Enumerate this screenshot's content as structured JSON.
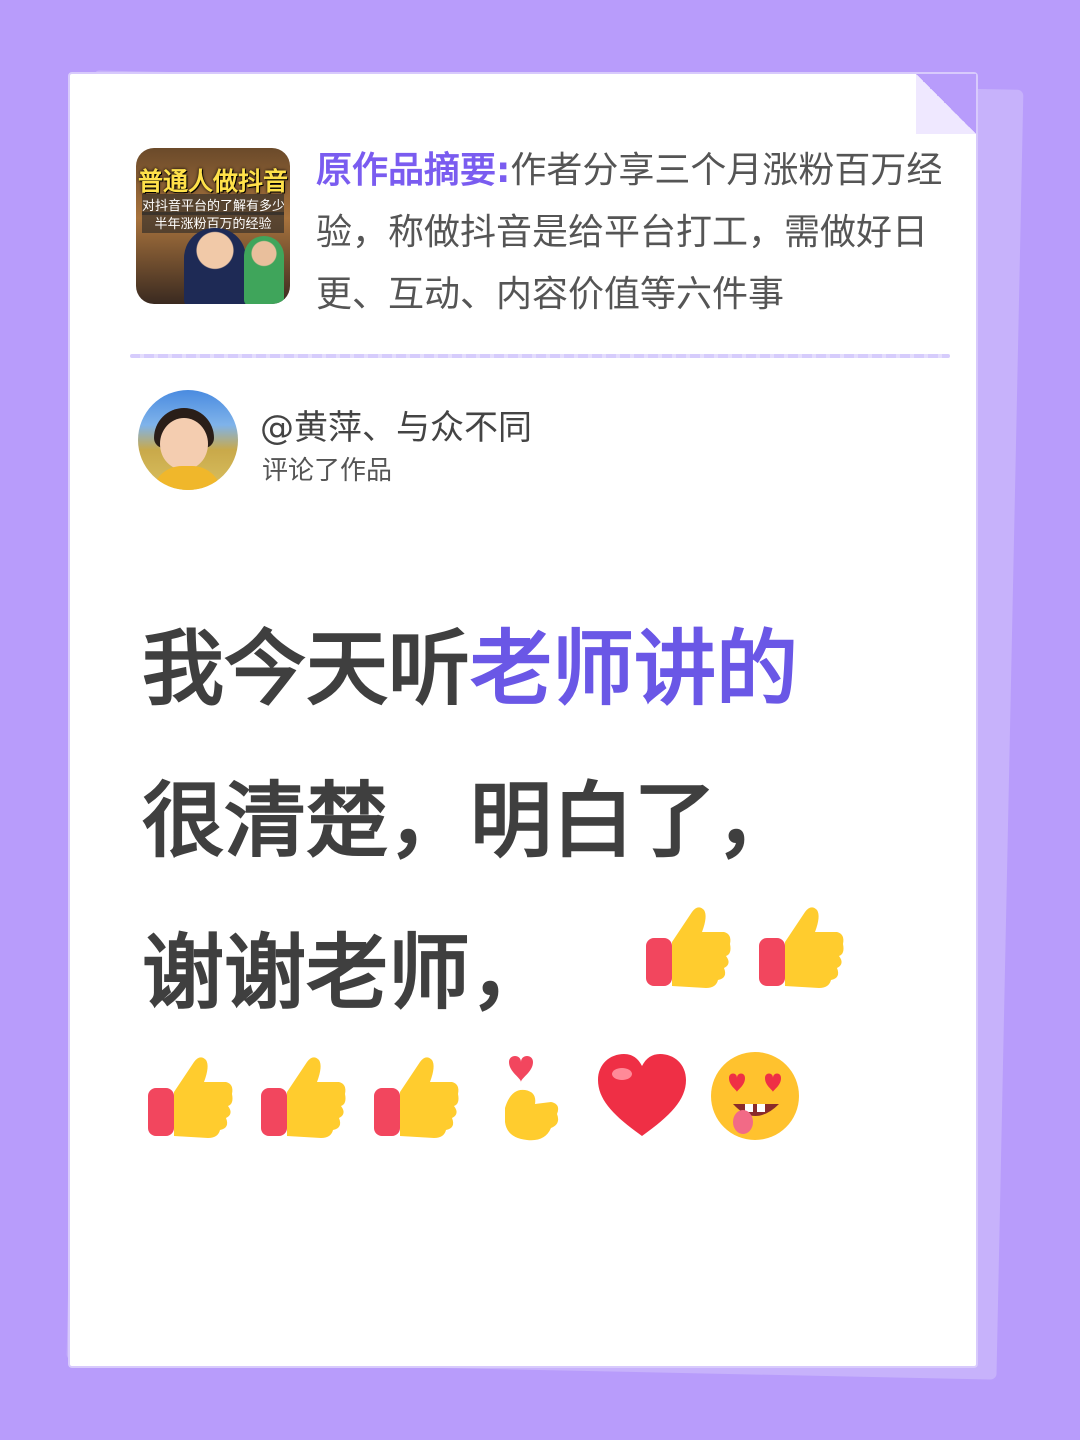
{
  "summary": {
    "label": "原作品摘要:",
    "text": "作者分享三个月涨粉百万经验，称做抖音是给平台打工，需做好日更、互动、内容价值等六件事"
  },
  "thumbnail": {
    "title": "普通人做抖音",
    "line2": "对抖音平台的了解有多少",
    "line3": "半年涨粉百万的经验"
  },
  "commenter": {
    "name": "@黄萍、与众不同",
    "action": "评论了作品"
  },
  "comment": {
    "part1": "我今天听",
    "highlight": "老师讲的",
    "part2": "很清楚，明白了，",
    "part3": "谢谢老师，"
  },
  "emojis": {
    "line1": [
      "thumbs-up-icon",
      "thumbs-up-icon"
    ],
    "line2": [
      "thumbs-up-icon",
      "thumbs-up-icon",
      "thumbs-up-icon",
      "finger-heart-icon",
      "red-heart-icon",
      "heart-eyes-face-icon"
    ]
  },
  "colors": {
    "background": "#b89cfb",
    "accent": "#6a57e6",
    "label": "#7a5cf0"
  }
}
